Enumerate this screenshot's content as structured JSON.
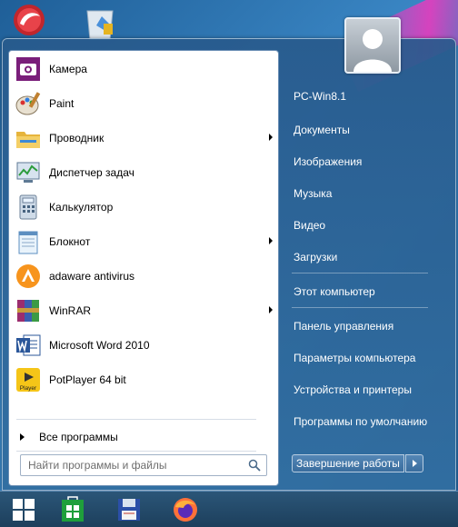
{
  "colors": {
    "menu_bg": "#2f6a9e",
    "left_pane_bg": "#ffffff",
    "taskbar_bg": "#1d3f5c",
    "right_text": "#ffffff"
  },
  "desktop": {
    "icons": [
      {
        "name": "comodo-dragon-icon"
      },
      {
        "name": "recycle-bin-icon"
      }
    ]
  },
  "start_menu": {
    "programs": [
      {
        "label": "Камера",
        "icon": "camera-icon",
        "has_submenu": false
      },
      {
        "label": "Paint",
        "icon": "paint-icon",
        "has_submenu": false
      },
      {
        "label": "Проводник",
        "icon": "explorer-icon",
        "has_submenu": true
      },
      {
        "label": "Диспетчер задач",
        "icon": "task-manager-icon",
        "has_submenu": false
      },
      {
        "label": "Калькулятор",
        "icon": "calculator-icon",
        "has_submenu": false
      },
      {
        "label": "Блокнот",
        "icon": "notepad-icon",
        "has_submenu": true
      },
      {
        "label": "adaware antivirus",
        "icon": "adaware-icon",
        "has_submenu": false
      },
      {
        "label": "WinRAR",
        "icon": "winrar-icon",
        "has_submenu": true
      },
      {
        "label": "Microsoft Word 2010",
        "icon": "word-icon",
        "has_submenu": false
      },
      {
        "label": "PotPlayer 64 bit",
        "icon": "potplayer-icon",
        "has_submenu": false
      }
    ],
    "potplayer_badge": "Player",
    "all_programs_label": "Все программы",
    "search": {
      "placeholder": "Найти программы и файлы",
      "value": ""
    },
    "right_items": [
      {
        "label": "PC-Win8.1"
      },
      {
        "label": "Документы"
      },
      {
        "label": "Изображения"
      },
      {
        "label": "Музыка"
      },
      {
        "label": "Видео"
      },
      {
        "label": "Загрузки"
      },
      {
        "label": "Этот компьютер"
      },
      {
        "label": "Панель управления"
      },
      {
        "label": "Параметры компьютера"
      },
      {
        "label": "Устройства и принтеры"
      },
      {
        "label": "Программы по умолчанию"
      }
    ],
    "shutdown_label": "Завершение работы"
  },
  "taskbar": {
    "items": [
      {
        "name": "start-button"
      },
      {
        "name": "store-icon"
      },
      {
        "name": "floppy-icon"
      },
      {
        "name": "firefox-icon"
      }
    ]
  }
}
